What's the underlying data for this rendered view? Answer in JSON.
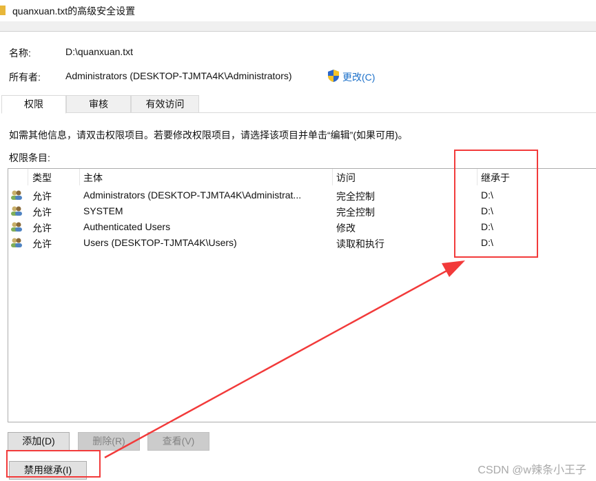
{
  "window": {
    "title": "quanxuan.txt的高级安全设置"
  },
  "info": {
    "name_label": "名称:",
    "name_value": "D:\\quanxuan.txt",
    "owner_label": "所有者:",
    "owner_value": "Administrators (DESKTOP-TJMTA4K\\Administrators)",
    "change_link": "更改(C)"
  },
  "tabs": [
    {
      "label": "权限"
    },
    {
      "label": "审核"
    },
    {
      "label": "有效访问"
    }
  ],
  "hint": "如需其他信息，请双击权限项目。若要修改权限项目，请选择该项目并单击“编辑”(如果可用)。",
  "list_label": "权限条目:",
  "columns": {
    "type": "类型",
    "principal": "主体",
    "access": "访问",
    "inherited": "继承于"
  },
  "rows": [
    {
      "type": "允许",
      "principal": "Administrators (DESKTOP-TJMTA4K\\Administrat...",
      "access": "完全控制",
      "inherited": "D:\\"
    },
    {
      "type": "允许",
      "principal": "SYSTEM",
      "access": "完全控制",
      "inherited": "D:\\"
    },
    {
      "type": "允许",
      "principal": "Authenticated Users",
      "access": "修改",
      "inherited": "D:\\"
    },
    {
      "type": "允许",
      "principal": "Users (DESKTOP-TJMTA4K\\Users)",
      "access": "读取和执行",
      "inherited": "D:\\"
    }
  ],
  "buttons": {
    "add": "添加(D)",
    "remove": "删除(R)",
    "view": "查看(V)",
    "disable_inheritance": "禁用继承(I)"
  },
  "watermark": "CSDN @w辣条小王子",
  "colors": {
    "annotation": "#f23a3a",
    "link": "#1a6fc9"
  }
}
